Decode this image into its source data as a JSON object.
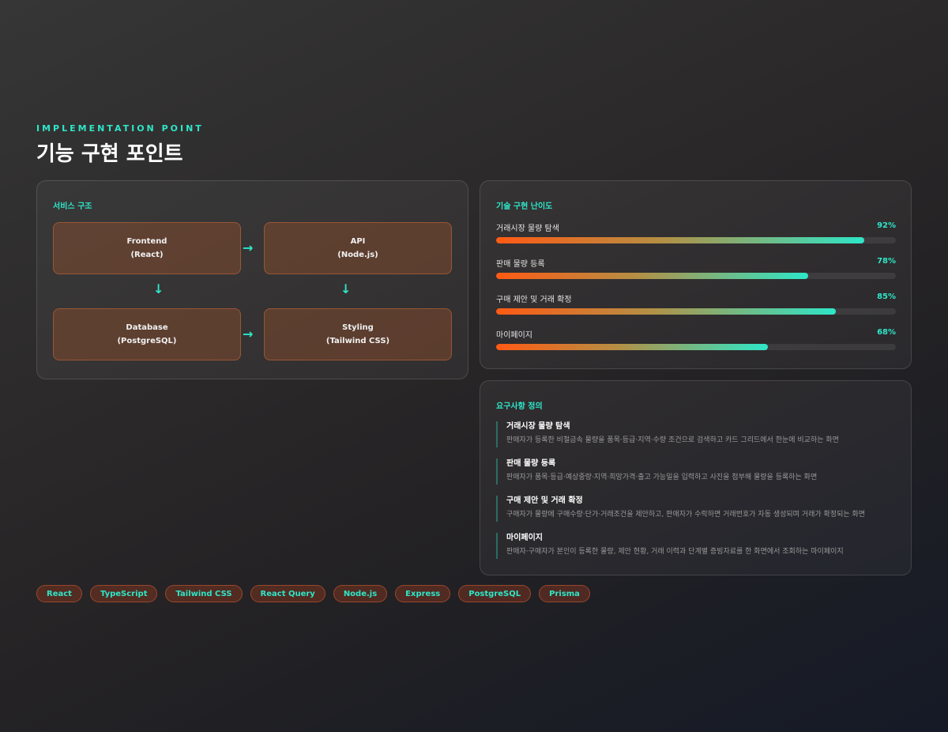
{
  "header": {
    "kicker": "IMPLEMENTATION POINT",
    "title": "기능 구현 포인트"
  },
  "architecture": {
    "title": "서비스 구조",
    "nodes": [
      {
        "name": "Frontend",
        "tech": "(React)"
      },
      {
        "name": "API",
        "tech": "(Node.js)"
      },
      {
        "name": "Database",
        "tech": "(PostgreSQL)"
      },
      {
        "name": "Styling",
        "tech": "(Tailwind CSS)"
      }
    ],
    "arrow_right": "→",
    "arrow_down": "↓"
  },
  "difficulty": {
    "title": "기술 구현 난이도",
    "items": [
      {
        "label": "거래시장 물량 탐색",
        "value_text": "92%",
        "value": 92
      },
      {
        "label": "판매 물량 등록",
        "value_text": "78%",
        "value": 78
      },
      {
        "label": "구매 제안 및 거래 확정",
        "value_text": "85%",
        "value": 85
      },
      {
        "label": "마이페이지",
        "value_text": "68%",
        "value": 68
      }
    ]
  },
  "requirements": {
    "title": "요구사항 정의",
    "items": [
      {
        "title": "거래시장 물량 탐색",
        "desc": "판매자가 등록한 비철금속 물량을 품목·등급·지역·수량 조건으로 검색하고 카드 그리드에서 한눈에 비교하는 화면"
      },
      {
        "title": "판매 물량 등록",
        "desc": "판매자가 품목·등급·예상중량·지역·희망가격·출고 가능일을 입력하고 사진을 첨부해 물량을 등록하는 화면"
      },
      {
        "title": "구매 제안 및 거래 확정",
        "desc": "구매자가 물량에 구매수량·단가·거래조건을 제안하고, 판매자가 수락하면 거래번호가 자동 생성되며 거래가 확정되는 화면"
      },
      {
        "title": "마이페이지",
        "desc": "판매자·구매자가 본인이 등록한 물량, 제안 현황, 거래 이력과 단계별 증빙자료를 한 화면에서 조회하는 마이페이지"
      }
    ]
  },
  "tags": [
    "React",
    "TypeScript",
    "Tailwind CSS",
    "React Query",
    "Node.js",
    "Express",
    "PostgreSQL",
    "Prisma"
  ],
  "colors": {
    "accent": "#2ee6c8",
    "orange": "#ff5a14"
  }
}
